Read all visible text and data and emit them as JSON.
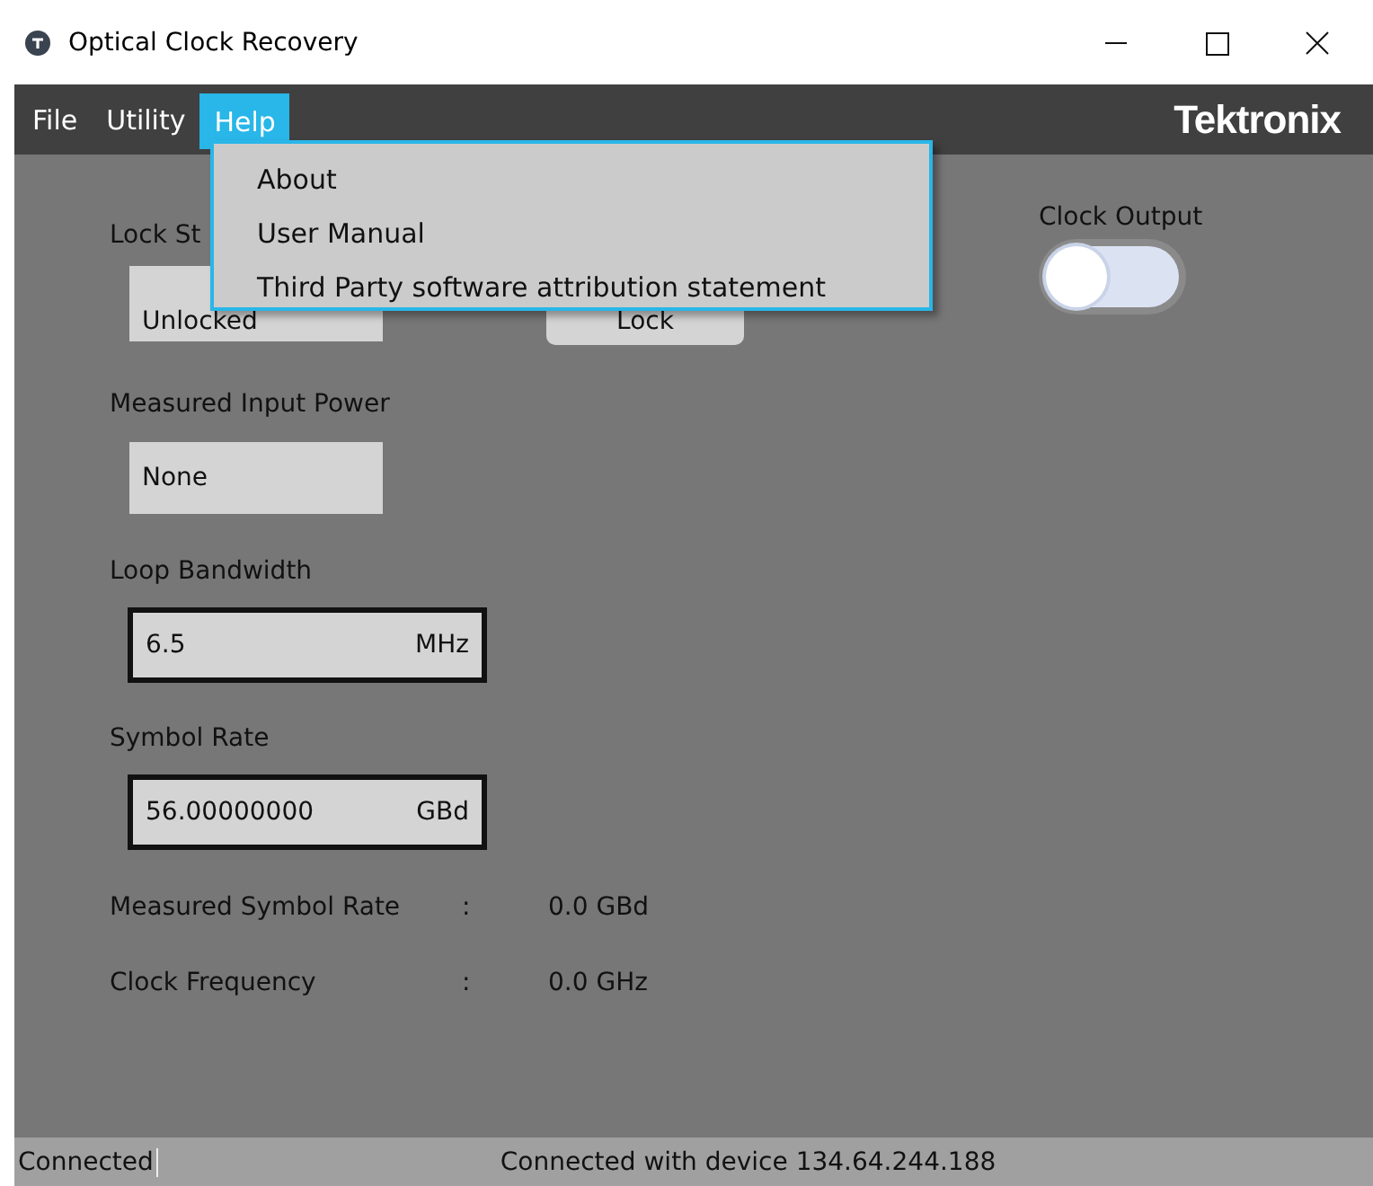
{
  "window": {
    "title": "Optical Clock Recovery"
  },
  "menu_bar": [
    {
      "label": "File",
      "selected": false
    },
    {
      "label": "Utility",
      "selected": false
    },
    {
      "label": "Help",
      "selected": true
    }
  ],
  "brand": "Tektronix",
  "help_menu": [
    "About",
    "User Manual",
    "Third Party software attribution statement"
  ],
  "lock_status": {
    "label": "Lock St",
    "value": "Unlocked"
  },
  "lock_button": "Lock",
  "clock_output": {
    "label": "Clock Output",
    "on": false
  },
  "measured_input_power": {
    "label": "Measured Input Power",
    "value": "None"
  },
  "loop_bandwidth": {
    "label": "Loop Bandwidth",
    "value": "6.5",
    "unit": "MHz"
  },
  "symbol_rate": {
    "label": "Symbol Rate",
    "value": "56.00000000",
    "unit": "GBd"
  },
  "readings": [
    {
      "label": "Measured Symbol Rate",
      "separator": ":",
      "value": "0.0 GBd"
    },
    {
      "label": "Clock Frequency",
      "separator": ":",
      "value": "0.0 GHz"
    }
  ],
  "status_bar": {
    "state": "Connected",
    "message": "Connected with device 134.64.244.188"
  }
}
